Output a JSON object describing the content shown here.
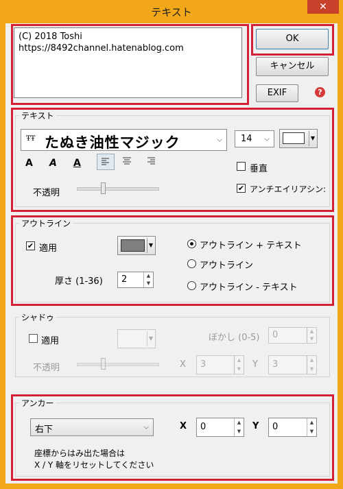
{
  "window": {
    "title": "テキスト",
    "close_label": "✕"
  },
  "textarea": {
    "value": "(C) 2018 Toshi\nhttps://8492channel.hatenablog.com"
  },
  "buttons": {
    "ok": "OK",
    "cancel": "キャンセル",
    "exif": "EXIF",
    "help_symbol": "?"
  },
  "text_group": {
    "legend": "テキスト",
    "font_icon_text": "ŦŦ",
    "font_name": "たぬき油性マジック",
    "font_size": "14",
    "style_bold": "A",
    "style_italic": "A",
    "style_underline": "A",
    "vertical_label": "垂直",
    "vertical_checked": false,
    "opacity_label": "不透明",
    "opacity_level": 0.4,
    "antialias_label": "アンチエイリアシン:",
    "antialias_checked": true
  },
  "outline_group": {
    "legend": "アウトライン",
    "apply_label": "適用",
    "apply_checked": true,
    "thickness_label": "厚さ (1-36)",
    "thickness_value": "2",
    "options": [
      "アウトライン + テキスト",
      "アウトライン",
      "アウトライン - テキスト"
    ],
    "selected_index": 0
  },
  "shadow_group": {
    "legend": "シャドゥ",
    "apply_label": "適用",
    "apply_checked": false,
    "blur_label": "ぼかし (0-5)",
    "blur_value": "0",
    "opacity_label": "不透明",
    "opacity_level": 0.4,
    "x_label": "X",
    "x_value": "3",
    "y_label": "Y",
    "y_value": "3"
  },
  "anchor_group": {
    "legend": "アンカー",
    "position": "右下",
    "x_label": "X",
    "x_value": "0",
    "y_label": "Y",
    "y_value": "0",
    "note_line1": "座標からはみ出た場合は",
    "note_line2": "X / Y 軸をリセットしてください"
  },
  "colors": {
    "highlight": "#d51f35",
    "frame": "#f2a61a",
    "close": "#c7412b",
    "outline_swatch": "#7f7f7f",
    "text_swatch": "#ffffff"
  }
}
